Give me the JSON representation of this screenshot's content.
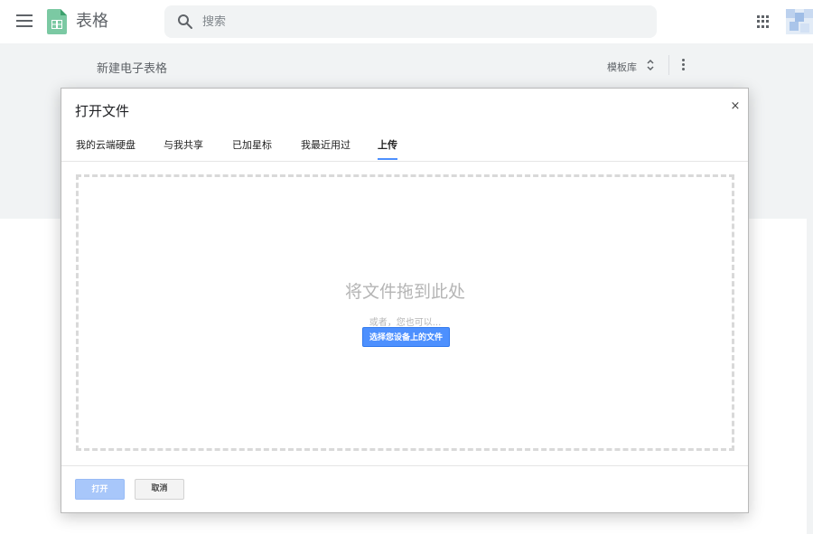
{
  "header": {
    "app_title": "表格",
    "search_placeholder": "搜索"
  },
  "start_panel": {
    "new_sheet_label": "新建电子表格",
    "template_gallery_label": "模板库"
  },
  "dialog": {
    "title": "打开文件",
    "close_label": "×",
    "tabs": [
      {
        "label": "我的云端硬盘",
        "active": false
      },
      {
        "label": "与我共享",
        "active": false
      },
      {
        "label": "已加星标",
        "active": false
      },
      {
        "label": "我最近用过",
        "active": false
      },
      {
        "label": "上传",
        "active": true
      }
    ],
    "upload": {
      "drop_title": "将文件拖到此处",
      "or_text": "或者，您也可以...",
      "select_button": "选择您设备上的文件"
    },
    "footer": {
      "open_button": "打开",
      "cancel_button": "取消"
    }
  },
  "colors": {
    "accent": "#4d90fe",
    "sheets_green": "#0f9d58",
    "band_bg": "#f1f3f4"
  }
}
